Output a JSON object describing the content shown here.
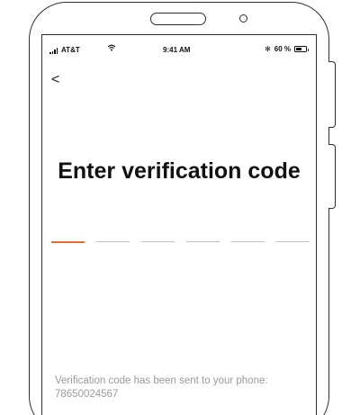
{
  "status_bar": {
    "carrier": "AT&T",
    "time": "9:41 AM",
    "bluetooth_symbol": "✻",
    "battery_percent": "60 %",
    "battery_level": 0.6
  },
  "nav": {
    "back_symbol": "<"
  },
  "page": {
    "title": "Enter verification code"
  },
  "code_input": {
    "length": 6,
    "active_index": 0,
    "active_color": "#e36b34",
    "inactive_color": "#bdbdbd",
    "digits": [
      "",
      "",
      "",
      "",
      "",
      ""
    ]
  },
  "footer": {
    "message": "Verification code has been sent to your phone:",
    "phone": "78650024567"
  },
  "icons": [
    "signal-icon",
    "wifi-icon",
    "bluetooth-icon",
    "battery-icon",
    "back-chevron-icon"
  ]
}
